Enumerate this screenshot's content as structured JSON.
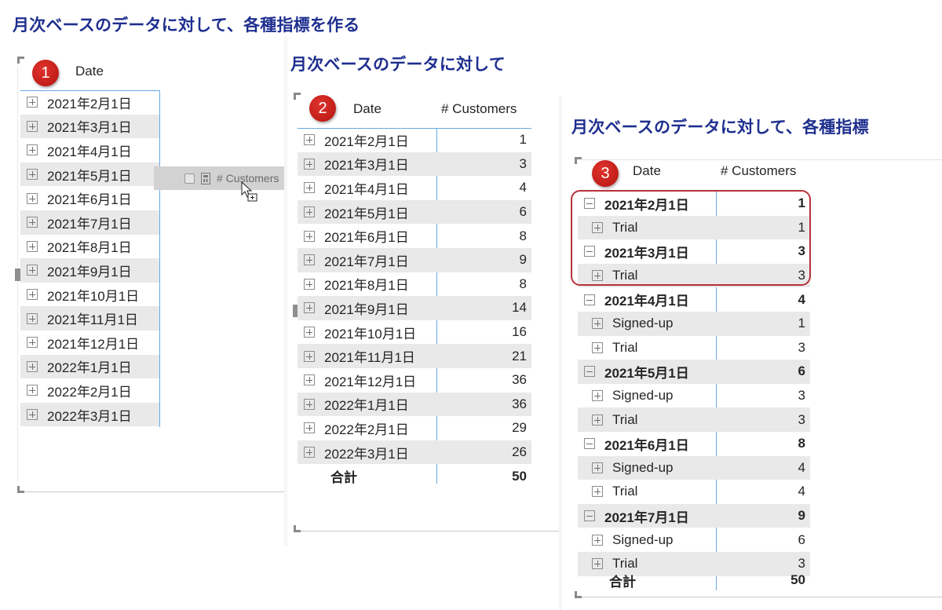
{
  "slides": [
    {
      "title": "月次ベースのデータに対して、各種指標を作る",
      "badge": "1",
      "header": {
        "date": "Date"
      },
      "rows": [
        "2021年2月1日",
        "2021年3月1日",
        "2021年4月1日",
        "2021年5月1日",
        "2021年6月1日",
        "2021年7月1日",
        "2021年8月1日",
        "2021年9月1日",
        "2021年10月1日",
        "2021年11月1日",
        "2021年12月1日",
        "2022年1月1日",
        "2022年2月1日",
        "2022年3月1日"
      ],
      "drag_field": "# Customers"
    },
    {
      "title": "月次ベースのデータに対して",
      "badge": "2",
      "header": {
        "date": "Date",
        "customers": "# Customers"
      },
      "rows": [
        {
          "date": "2021年2月1日",
          "value": "1"
        },
        {
          "date": "2021年3月1日",
          "value": "3"
        },
        {
          "date": "2021年4月1日",
          "value": "4"
        },
        {
          "date": "2021年5月1日",
          "value": "6"
        },
        {
          "date": "2021年6月1日",
          "value": "8"
        },
        {
          "date": "2021年7月1日",
          "value": "9"
        },
        {
          "date": "2021年8月1日",
          "value": "8"
        },
        {
          "date": "2021年9月1日",
          "value": "14"
        },
        {
          "date": "2021年10月1日",
          "value": "16"
        },
        {
          "date": "2021年11月1日",
          "value": "21"
        },
        {
          "date": "2021年12月1日",
          "value": "36"
        },
        {
          "date": "2022年1月1日",
          "value": "36"
        },
        {
          "date": "2022年2月1日",
          "value": "29"
        },
        {
          "date": "2022年3月1日",
          "value": "26"
        }
      ],
      "total": {
        "label": "合計",
        "value": "50"
      }
    },
    {
      "title": "月次ベースのデータに対して、各種指標",
      "badge": "3",
      "header": {
        "date": "Date",
        "customers": "# Customers"
      },
      "rows": [
        {
          "label": "2021年2月1日",
          "value": "1",
          "level": 0
        },
        {
          "label": "Trial",
          "value": "1",
          "level": 1
        },
        {
          "label": "2021年3月1日",
          "value": "3",
          "level": 0
        },
        {
          "label": "Trial",
          "value": "3",
          "level": 1
        },
        {
          "label": "2021年4月1日",
          "value": "4",
          "level": 0
        },
        {
          "label": "Signed-up",
          "value": "1",
          "level": 1
        },
        {
          "label": "Trial",
          "value": "3",
          "level": 1
        },
        {
          "label": "2021年5月1日",
          "value": "6",
          "level": 0
        },
        {
          "label": "Signed-up",
          "value": "3",
          "level": 1
        },
        {
          "label": "Trial",
          "value": "3",
          "level": 1
        },
        {
          "label": "2021年6月1日",
          "value": "8",
          "level": 0
        },
        {
          "label": "Signed-up",
          "value": "4",
          "level": 1
        },
        {
          "label": "Trial",
          "value": "4",
          "level": 1
        },
        {
          "label": "2021年7月1日",
          "value": "9",
          "level": 0
        },
        {
          "label": "Signed-up",
          "value": "6",
          "level": 1
        },
        {
          "label": "Trial",
          "value": "3",
          "level": 1
        }
      ],
      "total": {
        "label": "合計",
        "value": "50"
      }
    }
  ],
  "colors": {
    "title": "#1f2f8f",
    "badge": "#c4201a",
    "divider": "#67a9e6",
    "highlight": "#b8323a",
    "alt_row": "#e9e9e9"
  }
}
